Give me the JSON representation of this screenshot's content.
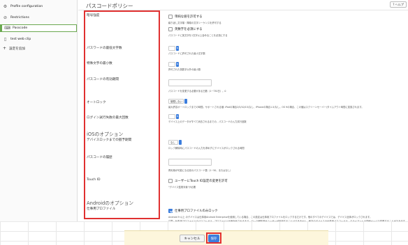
{
  "sidebar": {
    "items": [
      {
        "label": "Profile configuration",
        "icon": "profile-icon"
      },
      {
        "label": "Restrictions",
        "icon": "restrictions-icon"
      },
      {
        "label": "Passcode",
        "icon": "keypad-icon",
        "selected": true
      },
      {
        "label": "test web clip",
        "icon": "web-clip-icon"
      }
    ],
    "add_label": "設定を追加"
  },
  "header": {
    "title": "パスコードポリシー",
    "help_label": "ヘルプ"
  },
  "labels": {
    "strength": "暗号強度",
    "min_length": "パスワードの最低文字数",
    "special_chars": "特殊文字の最小数",
    "validity": "パスコードの有効期間",
    "autolock": "オートロック",
    "max_failed": "ログイン試行失敗の最大回数",
    "ios_section": "iOSのオプション",
    "grace": "デバイスロックまでの猶予期間",
    "history": "パスコードの履歴",
    "touchid": "Touch ID",
    "android_section": "Androidのオプション",
    "work_profile": "仕事用プロファイル"
  },
  "controls": {
    "allow_simple": "単純な値を許可する",
    "allow_simple_desc": "繰り返し文字順・降順の文字シーケンスを許可する",
    "require_alnum": "英数字を必須にする",
    "require_alnum_desc": "パスコードに英文字を1文字以上含めることを必須にする",
    "min_length_desc": "パスコードに許可された最小文字数",
    "special_desc": "許可された英数字以外の最小数",
    "validity_desc": "パスコードを変更する必要がある日数（1~730日）。0",
    "autolock_value": "制限しない",
    "autolock_desc": "最大許容オートロックまでの時間。サポートされる値: iPadの場合2/5/10/15/なし、iPhoneの場合1-5/なし。OS 9の場合、この値はスクリーンセーバー/タイムアウト時間に変換されます。",
    "max_failed_desc": "デバイス上のデータがすべて消去されるまでの、パスコードの入力試行回数",
    "grace_value": "なし",
    "grace_desc": "ロック解除時にパスコードの入力を求めずにデバイスがロックされる時間",
    "history_desc": "再利用が可能になる前のパスコード数（1~50、またはなし）",
    "touchid_label": "ユーザーにTouch ID設定の変更を許可",
    "touchid_desc": "\"デバイス監視対象\"が必要",
    "work_lock_label": "仕事用プロファイルのみロック",
    "work_lock_desc1": "Android 9 以上 のデバイスは仕事用Android Enterpriseを使用している場合、この設定は仕事用プロファイルをロックするだけです。他のすべてのデバイスでは、デバイス全体がロックされます。",
    "work_lock_desc2": "注意：仕事用プロファイルのパスコードは、プロファイルを無効化されるまで、ロック解除済みユーザーが利用することはできません。他方のデバイスの仕事用パスコードは、クライアントの詳細ページで変更することができます。"
  },
  "footer": {
    "cancel_label": "キャンセル",
    "save_label": "保存"
  },
  "colors": {
    "accent": "#3b7ddd",
    "highlight": "#e03030",
    "selected_border": "#6aa84f",
    "footer_bg": "#fdf6dc"
  }
}
